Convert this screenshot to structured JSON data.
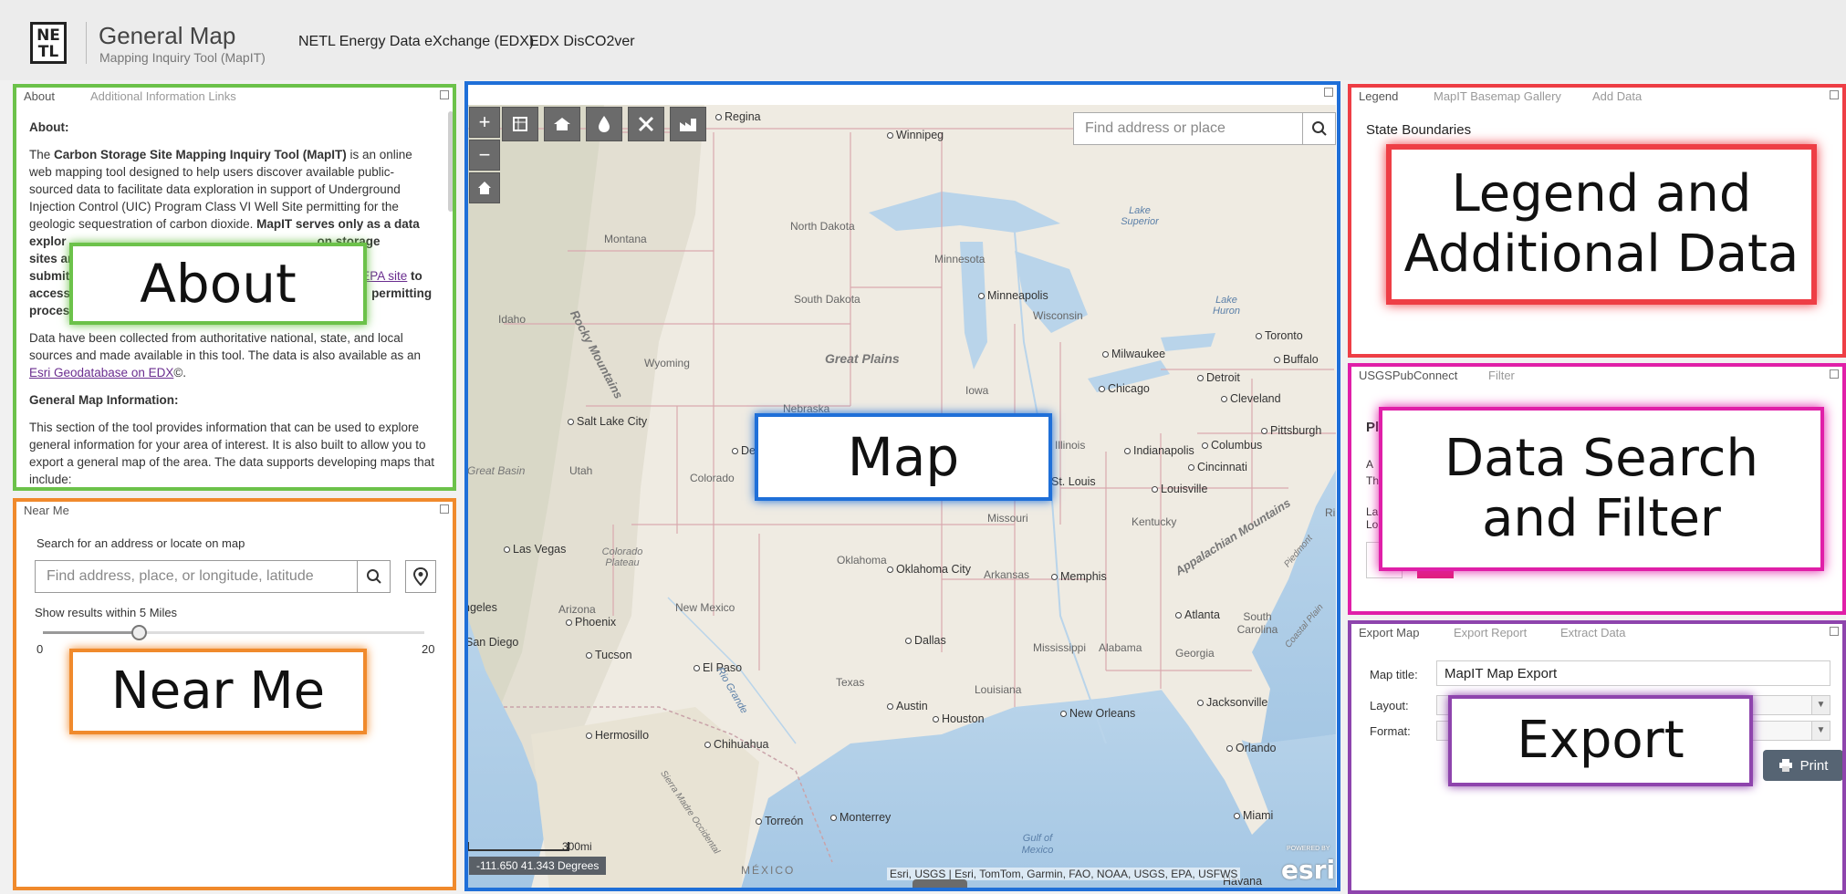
{
  "header": {
    "logo_text": "NE TL",
    "title": "General Map",
    "subtitle": "Mapping Inquiry Tool (MapIT)",
    "links": [
      "NETL Energy Data eXchange (EDX)",
      "EDX DisCO2ver"
    ]
  },
  "about_panel": {
    "tabs": [
      "About",
      "Additional Information Links"
    ],
    "heading": "About:",
    "para1_pre": "The ",
    "para1_bold": "Carbon Storage Site Mapping Inquiry Tool (MapIT)",
    "para1_post": " is an online web mapping tool designed to help users discover available public-sourced data to facilitate data exploration in support of Underground Injection Control (UIC) Program Class VI Well Site permitting for the geologic sequestration of carbon dioxide. ",
    "para1_bold2": "MapIT serves only as a data",
    "frag_explor": "explor",
    "frag_on_storage": "on storage",
    "frag_sites": "sites ar",
    "frag_submit": "submit",
    "frag_epa": "EPA site",
    "frag_to": " to",
    "frag_access": "access",
    "frag_permitting": "permitting",
    "frag_proces": "proces",
    "para2_pre": "Data have been collected from authoritative national, state, and local sources and made available in this tool. The data is also available as an ",
    "para2_link": "Esri Geodatabase on EDX",
    "para2_post": "©.",
    "heading2": "General Map Information:",
    "para3": "This section of the tool provides information that can be used to explore general information for your area of interest. It is also built to allow you to export a general map of the area. The data supports developing maps that include:"
  },
  "near_me": {
    "tab": "Near Me",
    "prompt": "Search for an address or locate on map",
    "placeholder": "Find address, place, or longitude, latitude",
    "distance_label": "Show results within 5 Miles",
    "slider_value": 5,
    "slider_min": "0",
    "slider_max": "20"
  },
  "map": {
    "search_placeholder": "Find address or place",
    "coords": "-111.650 41.343 Degrees",
    "scale": "300mi",
    "attribution": "Esri, USGS | Esri, TomTom, Garmin, FAO, NOAA, USGS, EPA, USFWS",
    "esri_powered": "POWERED BY",
    "esri": "esri",
    "zoom_in": "+",
    "zoom_out": "−",
    "cities": [
      {
        "name": "Regina"
      },
      {
        "name": "Winnipeg"
      },
      {
        "name": "Minneapolis"
      },
      {
        "name": "Milwaukee"
      },
      {
        "name": "Chicago"
      },
      {
        "name": "Detroit"
      },
      {
        "name": "Toronto"
      },
      {
        "name": "Buffalo"
      },
      {
        "name": "Cleveland"
      },
      {
        "name": "Pittsburgh"
      },
      {
        "name": "Columbus"
      },
      {
        "name": "Indianapolis"
      },
      {
        "name": "Cincinnati"
      },
      {
        "name": "Louisville"
      },
      {
        "name": "St. Louis"
      },
      {
        "name": "Salt Lake City"
      },
      {
        "name": "Denv"
      },
      {
        "name": "Las Vegas"
      },
      {
        "name": "Oklahoma City"
      },
      {
        "name": "Memphis"
      },
      {
        "name": "Atlanta"
      },
      {
        "name": "Phoenix"
      },
      {
        "name": "Tucson"
      },
      {
        "name": "San Diego"
      },
      {
        "name": "ngeles"
      },
      {
        "name": "Dallas"
      },
      {
        "name": "El Paso"
      },
      {
        "name": "Austin"
      },
      {
        "name": "Houston"
      },
      {
        "name": "New Orleans"
      },
      {
        "name": "Jacksonville"
      },
      {
        "name": "Orlando"
      },
      {
        "name": "Miami"
      },
      {
        "name": "Hermosillo"
      },
      {
        "name": "Chihuahua"
      },
      {
        "name": "Monterrey"
      },
      {
        "name": "Torreón"
      },
      {
        "name": "Havana"
      }
    ],
    "states": [
      "Montana",
      "North Dakota",
      "South Dakota",
      "Minnesota",
      "Wisconsin",
      "Idaho",
      "Wyoming",
      "Nebraska",
      "Iowa",
      "Utah",
      "Colorado",
      "Illinois",
      "Missouri",
      "Kentucky",
      "Oklahoma",
      "Arkansas",
      "Arizona",
      "New Mexico",
      "Texas",
      "Mississippi",
      "Alabama",
      "Georgia",
      "Louisiana",
      "South Carolina",
      "Ri"
    ],
    "regions": [
      "Rocky Mountains",
      "Great Plains",
      "Appalachian Mountains",
      "Great Basin",
      "Colorado Plateau",
      "Piedmont",
      "Coastal Plain",
      "MÉXICO",
      "Sierra Madre Occidental"
    ],
    "water": [
      "Lake Superior",
      "Lake Huron",
      "Gulf of Mexico",
      "Rio Grande"
    ]
  },
  "legend_panel": {
    "tabs": [
      "Legend",
      "MapIT Basemap Gallery",
      "Add Data"
    ],
    "item": "State Boundaries"
  },
  "usgs_panel": {
    "tabs": [
      "USGSPubConnect",
      "Filter"
    ],
    "frag1": "Pl",
    "frag2": "A",
    "frag3": "Th",
    "frag4": "La",
    "frag5": "Lo"
  },
  "export_panel": {
    "tabs": [
      "Export Map",
      "Export Report",
      "Extract Data"
    ],
    "map_title_label": "Map title:",
    "map_title_value": "MapIT Map Export",
    "layout_label": "Layout:",
    "format_label": "Format:",
    "print_label": "Print"
  },
  "overlays": {
    "about": "About",
    "near_me": "Near Me",
    "map": "Map",
    "legend": "Legend and Additional Data",
    "search": "Data Search and Filter",
    "export": "Export"
  },
  "colors": {
    "about": "#6cc24a",
    "near_me": "#f08a2c",
    "map": "#1f6fd8",
    "legend": "#ee3e45",
    "search": "#e01fa8",
    "export": "#8e44ad"
  }
}
